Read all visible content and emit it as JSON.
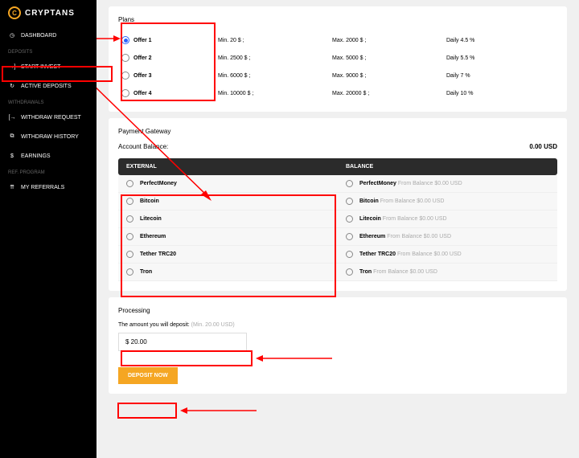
{
  "brand": {
    "name": "CRYPTANS",
    "logo_letter": "C"
  },
  "sidebar": {
    "dashboard": "DASHBOARD",
    "section_deposits": "DEPOSITS",
    "start_invest": "START INVEST",
    "active_deposits": "ACTIVE DEPOSITS",
    "section_withdrawals": "WITHDRAWALS",
    "withdraw_request": "WITHDRAW REQUEST",
    "withdraw_history": "WITHDRAW HISTORY",
    "earnings": "EARNINGS",
    "section_ref": "REF. PROGRAM",
    "my_referrals": "MY REFERRALS"
  },
  "plans": {
    "title": "Plans",
    "offers": [
      {
        "name": "Offer 1",
        "min": "Min. 20 $ ;",
        "max": "Max. 2000 $ ;",
        "daily": "Daily 4.5 %",
        "selected": true
      },
      {
        "name": "Offer 2",
        "min": "Min. 2500 $ ;",
        "max": "Max. 5000 $ ;",
        "daily": "Daily 5.5 %",
        "selected": false
      },
      {
        "name": "Offer 3",
        "min": "Min. 6000 $ ;",
        "max": "Max. 9000 $ ;",
        "daily": "Daily 7 %",
        "selected": false
      },
      {
        "name": "Offer 4",
        "min": "Min. 10000 $ ;",
        "max": "Max. 20000 $ ;",
        "daily": "Daily 10 %",
        "selected": false
      }
    ]
  },
  "gateway": {
    "title": "Payment Gateway",
    "balance_label": "Account Balance:",
    "balance_value": "0.00 USD",
    "col_external": "EXTERNAL",
    "col_balance": "BALANCE",
    "methods": [
      "PerfectMoney",
      "Bitcoin",
      "Litecoin",
      "Ethereum",
      "Tether TRC20",
      "Tron"
    ],
    "from_balance_suffix": "From Balance $0.00 USD"
  },
  "processing": {
    "title": "Processing",
    "label": "The amount you will deposit:",
    "hint": "(Min. 20.00 USD)",
    "value": "$ 20.00",
    "button": "DEPOSIT NOW"
  }
}
